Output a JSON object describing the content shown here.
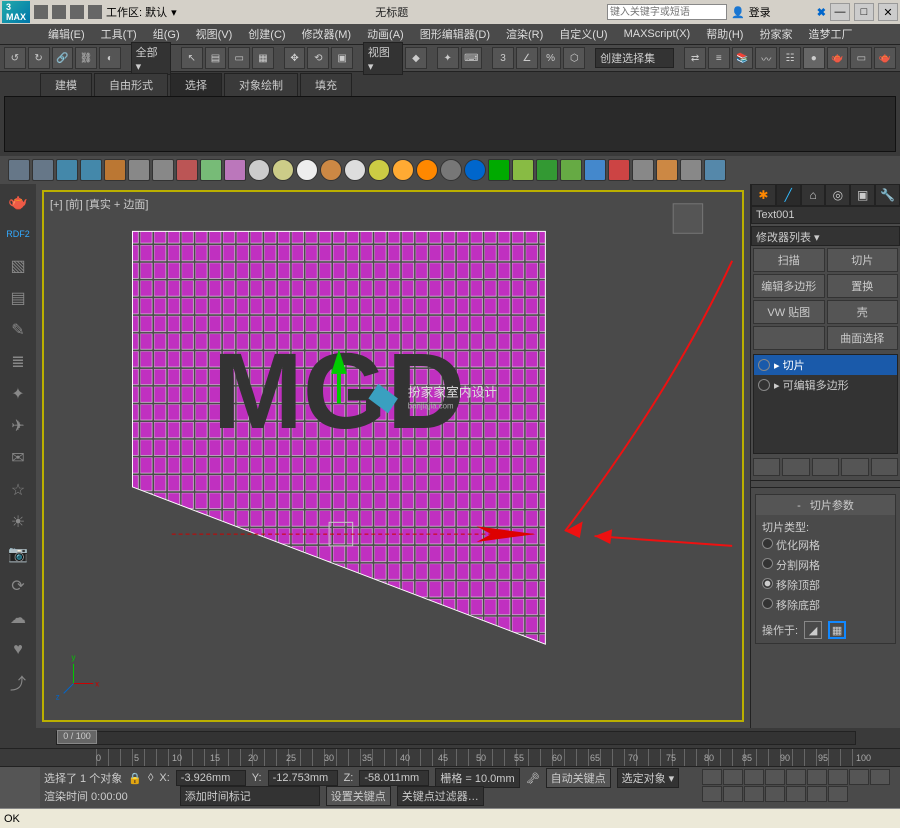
{
  "titlebar": {
    "workspace_label": "工作区: 默认",
    "title": "无标题",
    "search_placeholder": "键入关键字或短语",
    "login": "登录"
  },
  "menus": [
    "编辑(E)",
    "工具(T)",
    "组(G)",
    "视图(V)",
    "创建(C)",
    "修改器(M)",
    "动画(A)",
    "图形编辑器(D)",
    "渲染(R)",
    "自定义(U)",
    "MAXScript(X)",
    "帮助(H)",
    "扮家家",
    "造梦工厂"
  ],
  "toolbar2": {
    "all_label": "全部",
    "view_label": "视图",
    "selset_label": "创建选择集"
  },
  "tabs": [
    "建模",
    "自由形式",
    "选择",
    "对象绘制",
    "填充"
  ],
  "tab_active_index": 2,
  "viewport": {
    "label": "[+] [前] [真实 + 边面]",
    "mesh_text": "MGD",
    "watermark": "扮家家室内设计",
    "watermark_sub": "banjiajia.com"
  },
  "leftbar_rdf": "RDF2",
  "rightpanel": {
    "object_name": "Text001",
    "modifier_list": "修改器列表",
    "buttons": [
      "扫描",
      "切片",
      "编辑多边形",
      "置换",
      "VW 贴图",
      "壳",
      "",
      "曲面选择"
    ],
    "stack": [
      {
        "label": "切片",
        "selected": true
      },
      {
        "label": "可编辑多边形",
        "selected": false
      }
    ],
    "rollup_title": "切片参数",
    "slice_type_label": "切片类型:",
    "slice_types": [
      {
        "label": "优化网格",
        "checked": false
      },
      {
        "label": "分割网格",
        "checked": false
      },
      {
        "label": "移除顶部",
        "checked": true
      },
      {
        "label": "移除底部",
        "checked": false
      }
    ],
    "operate_label": "操作于:"
  },
  "timeline": {
    "pos": "0 / 100"
  },
  "ruler_ticks": [
    0,
    5,
    10,
    15,
    20,
    25,
    30,
    35,
    40,
    45,
    50,
    55,
    60,
    65,
    70,
    75,
    80,
    85,
    90,
    95,
    100
  ],
  "status": {
    "selected": "选择了 1 个对象",
    "x": "-3.926mm",
    "y": "-12.753mm",
    "z": "-58.011mm",
    "grid": "栅格 = 10.0mm",
    "autokey": "自动关键点",
    "selobj": "选定对象",
    "render_time": "渲染时间 0:00:00",
    "add_marker": "添加时间标记",
    "setkey": "设置关键点",
    "keyfilter": "关键点过滤器"
  },
  "prompt": "OK"
}
